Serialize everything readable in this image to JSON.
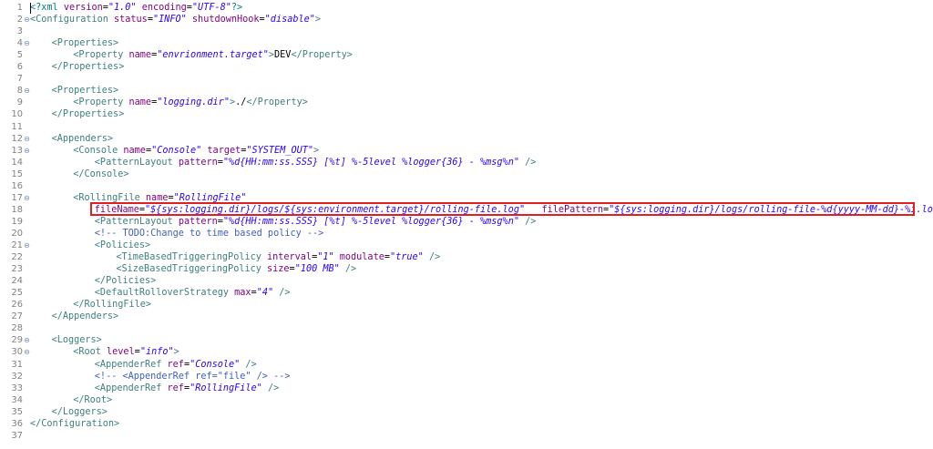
{
  "editor": {
    "lines": [
      {
        "n": "1",
        "indent": 0,
        "fold": false,
        "tokens": [
          [
            "decl",
            "<?xml "
          ],
          [
            "attr",
            "version"
          ],
          [
            "txt",
            "="
          ],
          [
            "val",
            "\"1.0\""
          ],
          [
            "txt",
            " "
          ],
          [
            "attr",
            "encoding"
          ],
          [
            "txt",
            "="
          ],
          [
            "val",
            "\"UTF-8\""
          ],
          [
            "decl",
            "?>"
          ]
        ]
      },
      {
        "n": "2",
        "indent": 0,
        "fold": true,
        "tokens": [
          [
            "tag",
            "<Configuration "
          ],
          [
            "attr",
            "status"
          ],
          [
            "txt",
            "="
          ],
          [
            "val",
            "\"INFO\""
          ],
          [
            "txt",
            " "
          ],
          [
            "attr",
            "shutdownHook"
          ],
          [
            "txt",
            "="
          ],
          [
            "val",
            "\"disable\""
          ],
          [
            "tag",
            ">"
          ]
        ]
      },
      {
        "n": "3",
        "indent": 0,
        "fold": false,
        "tokens": []
      },
      {
        "n": "4",
        "indent": 1,
        "fold": true,
        "tokens": [
          [
            "tag",
            "<Properties>"
          ]
        ]
      },
      {
        "n": "5",
        "indent": 2,
        "fold": false,
        "tokens": [
          [
            "tag",
            "<Property "
          ],
          [
            "attr",
            "name"
          ],
          [
            "txt",
            "="
          ],
          [
            "val",
            "\"envrionment.target\""
          ],
          [
            "tag",
            ">"
          ],
          [
            "txt",
            "DEV"
          ],
          [
            "tag",
            "</Property>"
          ]
        ]
      },
      {
        "n": "6",
        "indent": 1,
        "fold": false,
        "tokens": [
          [
            "tag",
            "</Properties>"
          ]
        ]
      },
      {
        "n": "7",
        "indent": 0,
        "fold": false,
        "tokens": []
      },
      {
        "n": "8",
        "indent": 1,
        "fold": true,
        "tokens": [
          [
            "tag",
            "<Properties>"
          ]
        ]
      },
      {
        "n": "9",
        "indent": 2,
        "fold": false,
        "tokens": [
          [
            "tag",
            "<Property "
          ],
          [
            "attr",
            "name"
          ],
          [
            "txt",
            "="
          ],
          [
            "val",
            "\"logging.dir\""
          ],
          [
            "tag",
            ">"
          ],
          [
            "txt",
            "./"
          ],
          [
            "tag",
            "</Property>"
          ]
        ]
      },
      {
        "n": "10",
        "indent": 1,
        "fold": false,
        "tokens": [
          [
            "tag",
            "</Properties>"
          ]
        ]
      },
      {
        "n": "11",
        "indent": 0,
        "fold": false,
        "tokens": []
      },
      {
        "n": "12",
        "indent": 1,
        "fold": true,
        "tokens": [
          [
            "tag",
            "<Appenders>"
          ]
        ]
      },
      {
        "n": "13",
        "indent": 2,
        "fold": true,
        "tokens": [
          [
            "tag",
            "<Console "
          ],
          [
            "attr",
            "name"
          ],
          [
            "txt",
            "="
          ],
          [
            "val",
            "\"Console\""
          ],
          [
            "txt",
            " "
          ],
          [
            "attr",
            "target"
          ],
          [
            "txt",
            "="
          ],
          [
            "val",
            "\"SYSTEM_OUT\""
          ],
          [
            "tag",
            ">"
          ]
        ]
      },
      {
        "n": "14",
        "indent": 3,
        "fold": false,
        "tokens": [
          [
            "tag",
            "<PatternLayout "
          ],
          [
            "attr",
            "pattern"
          ],
          [
            "txt",
            "="
          ],
          [
            "val",
            "\"%d{HH:mm:ss.SSS} [%t] %-5level %logger{36} - %msg%n\""
          ],
          [
            "txt",
            " "
          ],
          [
            "tag",
            "/>"
          ]
        ]
      },
      {
        "n": "15",
        "indent": 2,
        "fold": false,
        "tokens": [
          [
            "tag",
            "</Console>"
          ]
        ]
      },
      {
        "n": "16",
        "indent": 0,
        "fold": false,
        "tokens": []
      },
      {
        "n": "17",
        "indent": 2,
        "fold": true,
        "tokens": [
          [
            "tag",
            "<RollingFile "
          ],
          [
            "attr",
            "name"
          ],
          [
            "txt",
            "="
          ],
          [
            "val",
            "\"RollingFile\""
          ]
        ]
      },
      {
        "n": "18",
        "indent": 3,
        "fold": false,
        "tokens": [
          [
            "attr",
            "fileName"
          ],
          [
            "txt",
            "="
          ],
          [
            "val",
            "\"${sys:logging.dir}/logs/${sys:environment.target}/rolling-file.log\""
          ],
          [
            "txt",
            "   "
          ],
          [
            "attr",
            "filePattern"
          ],
          [
            "txt",
            "="
          ],
          [
            "val",
            "\"${sys:logging.dir}/logs/rolling-file-%d{yyyy-MM-dd}-%i.log\""
          ],
          [
            "tag",
            ">"
          ]
        ]
      },
      {
        "n": "19",
        "indent": 3,
        "fold": false,
        "tokens": [
          [
            "tag",
            "<PatternLayout "
          ],
          [
            "attr",
            "pattern"
          ],
          [
            "txt",
            "="
          ],
          [
            "val",
            "\"%d{HH:mm:ss.SSS} [%t] %-5level %logger{36} - %msg%n\""
          ],
          [
            "txt",
            " "
          ],
          [
            "tag",
            "/>"
          ]
        ]
      },
      {
        "n": "20",
        "indent": 3,
        "fold": false,
        "tokens": [
          [
            "cmt",
            "<!-- TODO:Change to time based policy -->"
          ]
        ]
      },
      {
        "n": "21",
        "indent": 3,
        "fold": true,
        "tokens": [
          [
            "tag",
            "<Policies>"
          ]
        ]
      },
      {
        "n": "22",
        "indent": 4,
        "fold": false,
        "tokens": [
          [
            "tag",
            "<TimeBasedTriggeringPolicy "
          ],
          [
            "attr",
            "interval"
          ],
          [
            "txt",
            "="
          ],
          [
            "val",
            "\"1\""
          ],
          [
            "txt",
            " "
          ],
          [
            "attr",
            "modulate"
          ],
          [
            "txt",
            "="
          ],
          [
            "val",
            "\"true\""
          ],
          [
            "txt",
            " "
          ],
          [
            "tag",
            "/>"
          ]
        ]
      },
      {
        "n": "23",
        "indent": 4,
        "fold": false,
        "tokens": [
          [
            "tag",
            "<SizeBasedTriggeringPolicy "
          ],
          [
            "attr",
            "size"
          ],
          [
            "txt",
            "="
          ],
          [
            "val",
            "\"100 MB\""
          ],
          [
            "txt",
            " "
          ],
          [
            "tag",
            "/>"
          ]
        ]
      },
      {
        "n": "24",
        "indent": 3,
        "fold": false,
        "tokens": [
          [
            "tag",
            "</Policies>"
          ]
        ]
      },
      {
        "n": "25",
        "indent": 3,
        "fold": false,
        "tokens": [
          [
            "tag",
            "<DefaultRolloverStrategy "
          ],
          [
            "attr",
            "max"
          ],
          [
            "txt",
            "="
          ],
          [
            "val",
            "\"4\""
          ],
          [
            "txt",
            " "
          ],
          [
            "tag",
            "/>"
          ]
        ]
      },
      {
        "n": "26",
        "indent": 2,
        "fold": false,
        "tokens": [
          [
            "tag",
            "</RollingFile>"
          ]
        ]
      },
      {
        "n": "27",
        "indent": 1,
        "fold": false,
        "tokens": [
          [
            "tag",
            "</Appenders>"
          ]
        ]
      },
      {
        "n": "28",
        "indent": 0,
        "fold": false,
        "tokens": []
      },
      {
        "n": "29",
        "indent": 1,
        "fold": true,
        "tokens": [
          [
            "tag",
            "<Loggers>"
          ]
        ]
      },
      {
        "n": "30",
        "indent": 2,
        "fold": true,
        "tokens": [
          [
            "tag",
            "<Root "
          ],
          [
            "attr",
            "level"
          ],
          [
            "txt",
            "="
          ],
          [
            "val",
            "\"info\""
          ],
          [
            "tag",
            ">"
          ]
        ]
      },
      {
        "n": "31",
        "indent": 3,
        "fold": false,
        "tokens": [
          [
            "tag",
            "<AppenderRef "
          ],
          [
            "attr",
            "ref"
          ],
          [
            "txt",
            "="
          ],
          [
            "val",
            "\"Console\""
          ],
          [
            "txt",
            " "
          ],
          [
            "tag",
            "/>"
          ]
        ]
      },
      {
        "n": "32",
        "indent": 3,
        "fold": false,
        "tokens": [
          [
            "cmt",
            "<!-- <AppenderRef ref=\"file\" /> -->"
          ]
        ]
      },
      {
        "n": "33",
        "indent": 3,
        "fold": false,
        "tokens": [
          [
            "tag",
            "<AppenderRef "
          ],
          [
            "attr",
            "ref"
          ],
          [
            "txt",
            "="
          ],
          [
            "val",
            "\"RollingFile\""
          ],
          [
            "txt",
            " "
          ],
          [
            "tag",
            "/>"
          ]
        ]
      },
      {
        "n": "34",
        "indent": 2,
        "fold": false,
        "tokens": [
          [
            "tag",
            "</Root>"
          ]
        ]
      },
      {
        "n": "35",
        "indent": 1,
        "fold": false,
        "tokens": [
          [
            "tag",
            "</Loggers>"
          ]
        ]
      },
      {
        "n": "36",
        "indent": 0,
        "fold": false,
        "tokens": [
          [
            "tag",
            "</Configuration>"
          ]
        ]
      },
      {
        "n": "37",
        "indent": 0,
        "fold": false,
        "tokens": []
      }
    ],
    "fold_glyph": "⊖",
    "highlighted_line": "18"
  },
  "colors": {
    "tag": "#3f7f7f",
    "attr": "#7f007f",
    "value": "#2a00ff",
    "comment": "#3f5fbf",
    "highlight_border": "#e02020"
  }
}
